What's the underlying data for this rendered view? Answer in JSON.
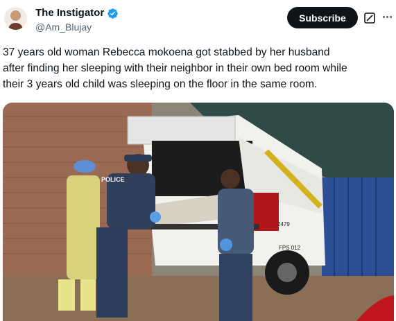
{
  "author": {
    "display_name": "The Instigator",
    "handle": "@Am_Blujay",
    "verified_icon": "verified-badge-icon",
    "avatar_icon": "user-avatar"
  },
  "actions": {
    "subscribe_label": "Subscribe",
    "grok_icon": "grok-icon",
    "more_icon": "more-horizontal-icon"
  },
  "tweet": {
    "text": "37 years old woman Rebecca mokoena got stabbed by her husband\nafter finding her sleeping with their neighbor in their own bed room while\ntheir 3 years old child was sleeping on the floor in the same room."
  },
  "media": {
    "vehicle_sign": "POLICE",
    "rear_number": "2479",
    "plate": "FPS 012"
  },
  "colors": {
    "accent_blue": "#1d9bf0",
    "button_dark": "#0f1419",
    "secondary_text": "#536471"
  }
}
